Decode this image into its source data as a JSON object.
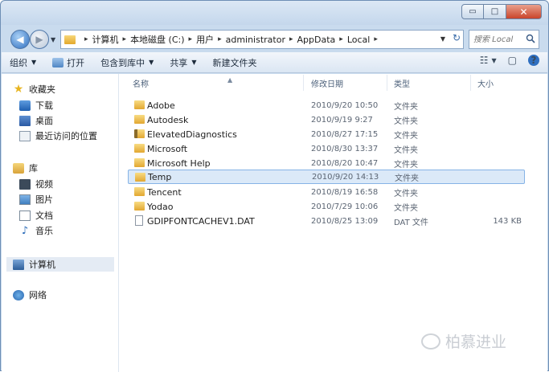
{
  "window": {
    "controls": {
      "minimize": "▭",
      "maximize": "□",
      "close": "✕"
    }
  },
  "nav": {
    "back": "◀",
    "forward": "▶",
    "address": {
      "crumbs": [
        "计算机",
        "本地磁盘 (C:)",
        "用户",
        "administrator",
        "AppData",
        "Local"
      ],
      "separator": "▸",
      "trailing_separator": "▸",
      "dropdown": "▼",
      "refresh": "↻"
    },
    "search": {
      "placeholder": "搜索 Local"
    }
  },
  "toolbar": {
    "organize": "组织",
    "open": "打开",
    "include_in_library": "包含到库中",
    "share": "共享",
    "new_folder": "新建文件夹",
    "caret": "▼",
    "views": "☷",
    "views_caret": "▼",
    "preview": "▢",
    "help": "?"
  },
  "sidebar": {
    "favorites": {
      "title": "收藏夹",
      "items": [
        {
          "label": "下载",
          "icon": "download-icon"
        },
        {
          "label": "桌面",
          "icon": "desktop-icon"
        },
        {
          "label": "最近访问的位置",
          "icon": "recent-places-icon"
        }
      ]
    },
    "libraries": {
      "title": "库",
      "items": [
        {
          "label": "视频",
          "icon": "video-icon"
        },
        {
          "label": "图片",
          "icon": "picture-icon"
        },
        {
          "label": "文档",
          "icon": "document-icon"
        },
        {
          "label": "音乐",
          "icon": "music-icon"
        }
      ]
    },
    "computer": {
      "label": "计算机",
      "icon": "computer-icon"
    },
    "network": {
      "label": "网络",
      "icon": "network-icon"
    }
  },
  "columns": {
    "name": "名称",
    "date": "修改日期",
    "type": "类型",
    "size": "大小",
    "sort_indicator": "▲"
  },
  "files": [
    {
      "name": "Adobe",
      "date": "2010/9/20 10:50",
      "type": "文件夹",
      "size": "",
      "icon": "folder-icon"
    },
    {
      "name": "Autodesk",
      "date": "2010/9/19 9:27",
      "type": "文件夹",
      "size": "",
      "icon": "folder-icon"
    },
    {
      "name": "ElevatedDiagnostics",
      "date": "2010/8/27 17:15",
      "type": "文件夹",
      "size": "",
      "icon": "folder-special-icon"
    },
    {
      "name": "Microsoft",
      "date": "2010/8/30 13:37",
      "type": "文件夹",
      "size": "",
      "icon": "folder-icon"
    },
    {
      "name": "Microsoft Help",
      "date": "2010/8/20 10:47",
      "type": "文件夹",
      "size": "",
      "icon": "folder-icon"
    },
    {
      "name": "Temp",
      "date": "2010/9/20 14:13",
      "type": "文件夹",
      "size": "",
      "icon": "folder-icon",
      "selected": true
    },
    {
      "name": "Tencent",
      "date": "2010/8/19 16:58",
      "type": "文件夹",
      "size": "",
      "icon": "folder-icon"
    },
    {
      "name": "Yodao",
      "date": "2010/7/29 10:06",
      "type": "文件夹",
      "size": "",
      "icon": "folder-icon"
    },
    {
      "name": "GDIPFONTCACHEV1.DAT",
      "date": "2010/8/25 13:09",
      "type": "DAT 文件",
      "size": "143 KB",
      "icon": "file-icon"
    }
  ],
  "watermark": "柏慕进业",
  "colors": {
    "selection_fill": "#dbe9f8",
    "selection_border": "#86b3e6",
    "frame": "#c9dbee"
  }
}
